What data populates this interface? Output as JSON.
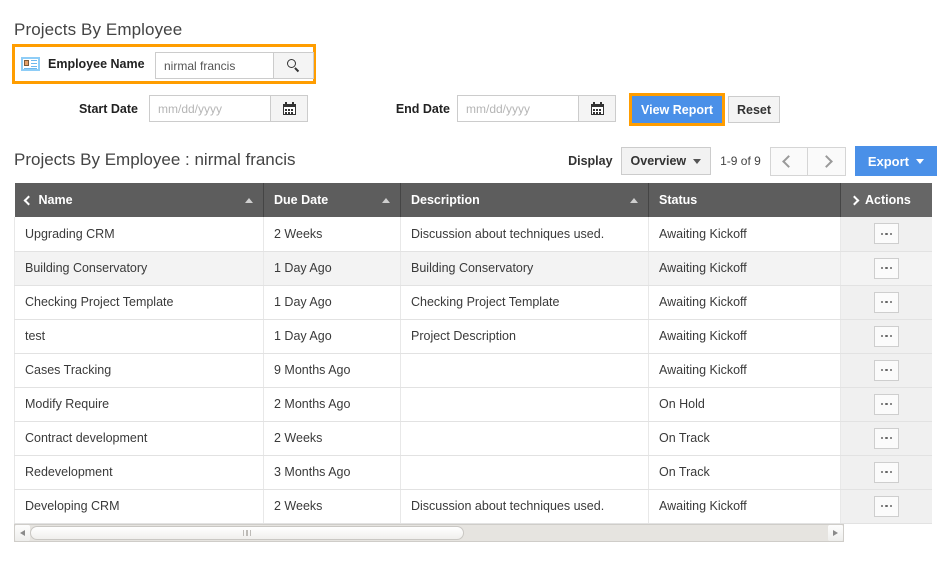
{
  "page": {
    "title": "Projects By Employee"
  },
  "filters": {
    "employee": {
      "icon": "contact-card-icon",
      "label": "Employee Name",
      "value": "nirmal francis",
      "placeholder": "",
      "search_icon": "search-icon"
    },
    "start_date": {
      "label": "Start Date",
      "value": "",
      "placeholder": "mm/dd/yyyy",
      "calendar_icon": "calendar-icon"
    },
    "end_date": {
      "label": "End Date",
      "value": "",
      "placeholder": "mm/dd/yyyy",
      "calendar_icon": "calendar-icon"
    },
    "view_report_label": "View Report",
    "reset_label": "Reset",
    "highlight_color": "#ff9d00",
    "primary_color": "#4a90e8"
  },
  "report": {
    "title": "Projects By Employee : nirmal francis",
    "display_label": "Display",
    "display_value": "Overview",
    "pagination_text": "1-9 of 9",
    "prev_icon": "chevron-left-icon",
    "next_icon": "chevron-right-icon",
    "export_label": "Export"
  },
  "table": {
    "columns": [
      {
        "label": "Name",
        "sort": "asc",
        "lead_icon": "chevron-left-icon"
      },
      {
        "label": "Due Date",
        "sort": "asc",
        "lead_icon": ""
      },
      {
        "label": "Description",
        "sort": "asc",
        "lead_icon": ""
      },
      {
        "label": "Status",
        "sort": "",
        "lead_icon": ""
      },
      {
        "label": "Actions",
        "sort": "",
        "lead_icon": "chevron-right-icon"
      }
    ],
    "rows": [
      {
        "name": "Upgrading CRM",
        "due": "2 Weeks",
        "description": "Discussion about techniques used.",
        "status": "Awaiting Kickoff",
        "action_icon": "ellipsis-icon"
      },
      {
        "name": "Building Conservatory",
        "due": "1 Day Ago",
        "description": "Building Conservatory",
        "status": "Awaiting Kickoff",
        "action_icon": "ellipsis-icon"
      },
      {
        "name": "Checking Project Template",
        "due": "1 Day Ago",
        "description": "Checking Project Template",
        "status": "Awaiting Kickoff",
        "action_icon": "ellipsis-icon"
      },
      {
        "name": "test",
        "due": "1 Day Ago",
        "description": "Project Description",
        "status": "Awaiting Kickoff",
        "action_icon": "ellipsis-icon"
      },
      {
        "name": "Cases Tracking",
        "due": "9 Months Ago",
        "description": "",
        "status": "Awaiting Kickoff",
        "action_icon": "ellipsis-icon"
      },
      {
        "name": "Modify Require",
        "due": "2 Months Ago",
        "description": "",
        "status": "On Hold",
        "action_icon": "ellipsis-icon"
      },
      {
        "name": "Contract development",
        "due": "2 Weeks",
        "description": "",
        "status": "On Track",
        "action_icon": "ellipsis-icon"
      },
      {
        "name": "Redevelopment",
        "due": "3 Months Ago",
        "description": "",
        "status": "On Track",
        "action_icon": "ellipsis-icon"
      },
      {
        "name": "Developing CRM",
        "due": "2 Weeks",
        "description": "Discussion about techniques used.",
        "status": "Awaiting Kickoff",
        "action_icon": "ellipsis-icon"
      }
    ]
  },
  "scrollbar": {
    "left_icon": "arrow-left-icon",
    "right_icon": "arrow-right-icon",
    "grip_icon": "grip-icon"
  }
}
